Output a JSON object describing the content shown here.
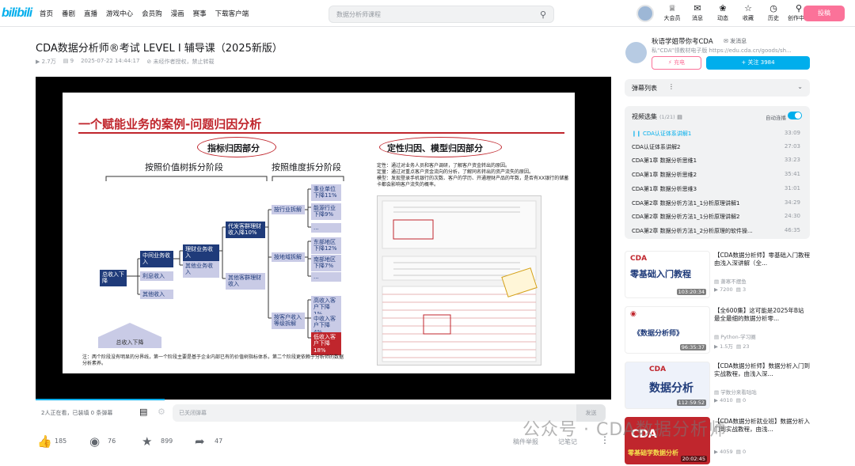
{
  "header": {
    "logo": "bilibili",
    "nav": [
      "首页",
      "番剧",
      "直播",
      "游戏中心",
      "会员购",
      "漫画",
      "赛事",
      "下载客户端"
    ],
    "search_placeholder": "数据分析师课程",
    "icons": [
      {
        "icon": "crown-icon",
        "label": "大会员"
      },
      {
        "icon": "message-icon",
        "label": "消息"
      },
      {
        "icon": "wind-icon",
        "label": "动态"
      },
      {
        "icon": "star-icon",
        "label": "收藏"
      },
      {
        "icon": "history-icon",
        "label": "历史"
      },
      {
        "icon": "bulb-icon",
        "label": "创作中心"
      }
    ],
    "upload_label": "投稿"
  },
  "video": {
    "title": "CDA数据分析师®考试 LEVEL Ⅰ 辅导课（2025新版）",
    "views": "2.7万",
    "danmaku": "9",
    "date": "2025-07-22 14:44:17",
    "copyright": "未经作者授权，禁止转载"
  },
  "slide": {
    "title": "一个赋能业务的案例-问题归因分析",
    "part1": "指标归因部分",
    "part2": "定性归因、模型归因部分",
    "stage1": "按照价值树拆分阶段",
    "stage2": "按照维度拆分阶段",
    "root": "总收入下降",
    "n_biz": "中间业务收入",
    "n_int": "利息收入",
    "n_oth": "其他收入",
    "n_wealth": "理财业务收入",
    "n_biz2": "其他业务收入",
    "n_agent": "代发客群理财收入降10%",
    "n_otherwealth": "其他客群理财收入",
    "d_industry": "按行业拆解",
    "d_region": "按地域拆解",
    "d_level": "按客户收入等级拆解",
    "l1": "事业单位下降11%",
    "l2": "能源行业下降9%",
    "l3": "...",
    "l4": "东部地区下降12%",
    "l5": "南部地区下降7%",
    "l6": "...",
    "l7": "高收入客户下降1%",
    "l8": "中收入客户下降4%",
    "l9": "低收入客户下降18%",
    "b1": "定性：通过对业务人员和客户调研，了解客户资金转出的原因。",
    "b2": "定量：通过对重点客户资金流向的分析，了解同名转出的资产流失的原因。",
    "b3": "模型：发现登录手机银行的次数、客户的学历、开通理财产品的年数，是否有XX银行的储蓄卡都会影响客户流失的概率。",
    "note": "注：两个阶段没有明显的分界线，第一个阶段主要是基于企业内部已有的价值树指标体系，第二个阶段更依赖于分析师的数据分析素养。",
    "ribbon": "总收入下降"
  },
  "player": {
    "watching": "2人正在看，已装填 0 条弹幕",
    "danmaku_placeholder": "已关闭弹幕",
    "send": "发送"
  },
  "toolbar": {
    "like": "185",
    "coin": "76",
    "fav": "899",
    "share": "47",
    "note": "稿件举报",
    "notes2": "记笔记"
  },
  "uploader": {
    "name": "秋语学姐带你考CDA",
    "message": "发消息",
    "desc": "私“CDA”领教材电子版 https://edu.cda.cn/goods/sh...",
    "charge": "充电",
    "follow": "+ 关注 3984"
  },
  "danmaku_list": {
    "title": "弹幕列表"
  },
  "episodes": {
    "title": "视频选集",
    "count": "(1/21)",
    "autoplay": "自动连播",
    "items": [
      {
        "name": "CDA认证体系讲解1",
        "dur": "33:09"
      },
      {
        "name": "CDA认证体系讲解2",
        "dur": "27:03"
      },
      {
        "name": "CDA第1章 数据分析思维1",
        "dur": "33:23"
      },
      {
        "name": "CDA第1章 数据分析思维2",
        "dur": "35:41"
      },
      {
        "name": "CDA第1章 数据分析思维3",
        "dur": "31:01"
      },
      {
        "name": "CDA第2章 数据分析方法1_1分析原理讲解1",
        "dur": "34:29"
      },
      {
        "name": "CDA第2章 数据分析方法1_1分析原理讲解2",
        "dur": "24:30"
      },
      {
        "name": "CDA第2章 数据分析方法1_2分析原理的软件操...",
        "dur": "46:35"
      }
    ]
  },
  "recommend": [
    {
      "title": "【CDA数据分析师】零基础入门教程 由浅入深讲解（全...",
      "author": "萧寒不摆鱼",
      "views": "7200",
      "dm": "3",
      "dur": "103:20:34",
      "thumb_text": "零基础入门教程",
      "color": "#ffffff"
    },
    {
      "title": "【全600集】这可能是2025年B站最全最细的数据分析零...",
      "author": "Python-学习圈",
      "views": "1.5万",
      "dm": "23",
      "dur": "96:35:37",
      "thumb_text": "《数据分析师》",
      "color": "#ffffff"
    },
    {
      "title": "【CDA数据分析师】数据分析入门到实战教程，由浅入深...",
      "author": "学数分来看咕咕",
      "views": "4010",
      "dm": "0",
      "dur": "112:59:52",
      "thumb_text": "数据分析",
      "color": "#ffffff"
    },
    {
      "title": "【CDA数据分析就业班】数据分析入门到实战教程，由浅...",
      "author": "",
      "views": "4059",
      "dm": "0",
      "dur": "20:02:45",
      "thumb_text": "零基础学数据分析",
      "color": "#c0262d"
    }
  ],
  "watermark": "公众号 · CDA数据分析师"
}
